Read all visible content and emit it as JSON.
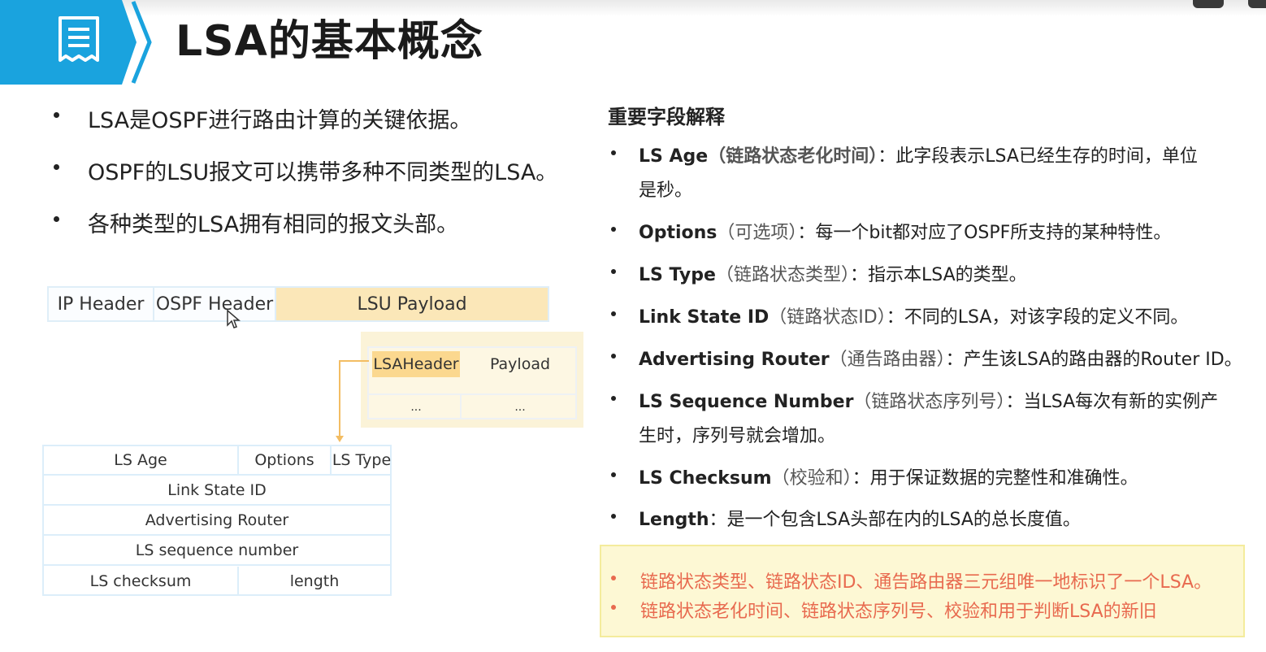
{
  "title": "LSA的基本概念",
  "bullets": [
    "LSA是OSPF进行路由计算的关键依据。",
    "OSPF的LSU报文可以携带多种不同类型的LSA。",
    "各种类型的LSA拥有相同的报文头部。"
  ],
  "diagram": {
    "packet": [
      "IP Header",
      "OSPF Header",
      "LSU Payload"
    ],
    "lsu_payload": {
      "row1": [
        "LSAHeader",
        "Payload"
      ],
      "row2": [
        "...",
        "..."
      ]
    },
    "lsa_header_fields": {
      "ls_age": "LS Age",
      "options": "Options",
      "ls_type": "LS Type",
      "link_state_id": "Link State ID",
      "advertising_router": "Advertising Router",
      "ls_sequence_number": "LS sequence number",
      "ls_checksum": "LS checksum",
      "length": "length"
    }
  },
  "fields": {
    "heading": "重要字段解释",
    "items": [
      {
        "key": "LS Age",
        "paren": "（链路状态老化时间）",
        "desc": "：此字段表示LSA已经生存的时间，单位",
        "cont": "是秒。"
      },
      {
        "key": "Options",
        "paren": "（可选项）",
        "desc": "：每一个bit都对应了OSPF所支持的某种特性。"
      },
      {
        "key": "LS Type",
        "paren": "（链路状态类型）",
        "desc": "：指示本LSA的类型。"
      },
      {
        "key": "Link State ID",
        "paren": "（链路状态ID）",
        "desc": "：不同的LSA，对该字段的定义不同。"
      },
      {
        "key": "Advertising Router",
        "paren": "（通告路由器）",
        "desc": "：产生该LSA的路由器的Router ID。"
      },
      {
        "key": "LS Sequence Number",
        "paren": "（链路状态序列号）",
        "desc": "：当LSA每次有新的实例产",
        "cont": "生时，序列号就会增加。"
      },
      {
        "key": "LS Checksum",
        "paren": "（校验和）",
        "desc": "：用于保证数据的完整性和准确性。"
      },
      {
        "key": "Length",
        "paren": "",
        "desc": "：是一个包含LSA头部在内的LSA的总长度值。"
      }
    ]
  },
  "notes": [
    "链路状态类型、链路状态ID、通告路由器三元组唯一地标识了一个LSA。",
    "链路状态老化时间、链路状态序列号、校验和用于判断LSA的新旧"
  ],
  "colors": {
    "banner_blue": "#1aa3de",
    "payload_fill": "#fbe7b8",
    "note_text": "#e86a4f",
    "note_bg": "#fdf8d4"
  }
}
